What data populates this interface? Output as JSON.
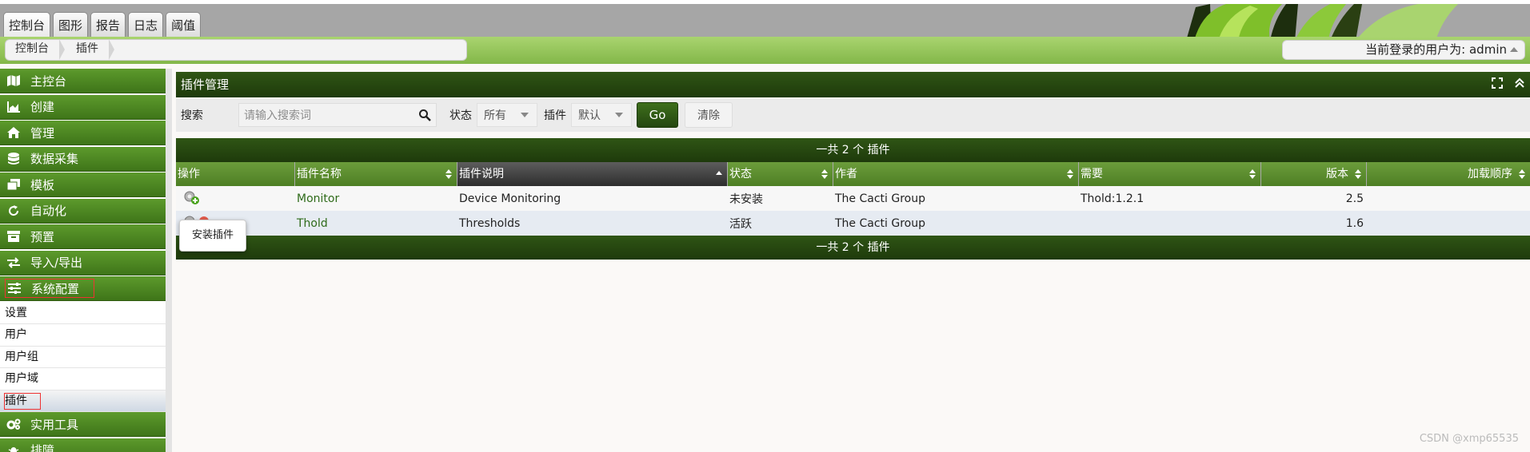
{
  "top_tabs": [
    "控制台",
    "图形",
    "报告",
    "日志",
    "阈值"
  ],
  "breadcrumb": [
    "控制台",
    "插件"
  ],
  "user_label": "当前登录的用户为: admin",
  "sidebar": {
    "items_top": [
      {
        "label": "主控台",
        "icon": "map-icon"
      },
      {
        "label": "创建",
        "icon": "area-chart-icon"
      },
      {
        "label": "管理",
        "icon": "home-icon"
      },
      {
        "label": "数据采集",
        "icon": "database-icon"
      },
      {
        "label": "模板",
        "icon": "clone-icon"
      },
      {
        "label": "自动化",
        "icon": "refresh-icon"
      },
      {
        "label": "预置",
        "icon": "archive-icon"
      },
      {
        "label": "导入/导出",
        "icon": "exchange-icon"
      },
      {
        "label": "系统配置",
        "icon": "sliders-icon"
      }
    ],
    "sub_items": [
      "设置",
      "用户",
      "用户组",
      "用户域",
      "插件"
    ],
    "items_bottom": [
      {
        "label": "实用工具",
        "icon": "cogs-icon"
      },
      {
        "label": "排障",
        "icon": "bug-icon"
      }
    ]
  },
  "panel": {
    "title": "插件管理",
    "search_label": "搜索",
    "search_placeholder": "请输入搜索词",
    "status_label": "状态",
    "status_value": "所有",
    "plugin_label": "插件",
    "plugin_value": "默认",
    "go_label": "Go",
    "clear_label": "清除",
    "count_text": "一共 2 个 插件"
  },
  "table": {
    "headers": [
      "操作",
      "插件名称",
      "插件说明",
      "状态",
      "作者",
      "需要",
      "版本",
      "加载顺序"
    ],
    "rows": [
      {
        "name": "Monitor",
        "desc": "Device Monitoring",
        "status": "未安装",
        "author": "The Cacti Group",
        "requires": "Thold:1.2.1",
        "version": "2.5",
        "order": ""
      },
      {
        "name": "Thold",
        "desc": "Thresholds",
        "status": "活跃",
        "author": "The Cacti Group",
        "requires": "",
        "version": "1.6",
        "order": ""
      }
    ]
  },
  "tooltip": "安装插件",
  "watermark": "CSDN @xmp65535",
  "colors": {
    "nav_green": "#4a8423",
    "header_dark_green": "#25450e",
    "link_green": "#2f6b1a",
    "highlight_red": "#ee3333"
  }
}
